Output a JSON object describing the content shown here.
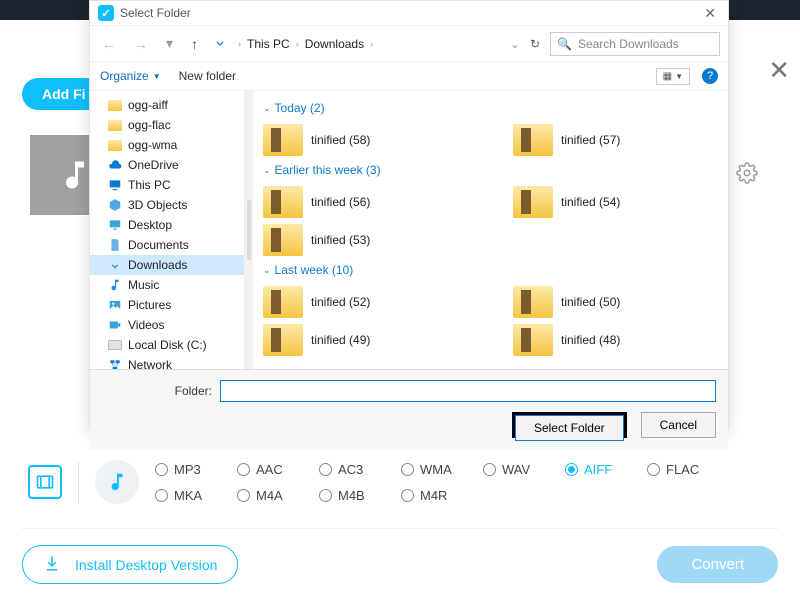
{
  "app": {
    "add_files_label": "Add Fi"
  },
  "dialog": {
    "title": "Select Folder",
    "nav": {
      "crumb_root": "This PC",
      "crumb_folder": "Downloads"
    },
    "search_placeholder": "Search Downloads",
    "toolbar": {
      "organize": "Organize",
      "new_folder": "New folder"
    },
    "tree": [
      {
        "label": "ogg-aiff",
        "icon": "folder",
        "selected": false
      },
      {
        "label": "ogg-flac",
        "icon": "folder",
        "selected": false
      },
      {
        "label": "ogg-wma",
        "icon": "folder",
        "selected": false
      },
      {
        "label": "OneDrive",
        "icon": "cloud",
        "selected": false
      },
      {
        "label": "This PC",
        "icon": "monitor",
        "selected": false
      },
      {
        "label": "3D Objects",
        "icon": "cube",
        "selected": false
      },
      {
        "label": "Desktop",
        "icon": "desktop",
        "selected": false
      },
      {
        "label": "Documents",
        "icon": "doc",
        "selected": false
      },
      {
        "label": "Downloads",
        "icon": "download",
        "selected": true
      },
      {
        "label": "Music",
        "icon": "music",
        "selected": false
      },
      {
        "label": "Pictures",
        "icon": "picture",
        "selected": false
      },
      {
        "label": "Videos",
        "icon": "video",
        "selected": false
      },
      {
        "label": "Local Disk (C:)",
        "icon": "drive",
        "selected": false
      },
      {
        "label": "Network",
        "icon": "network",
        "selected": false
      }
    ],
    "groups": [
      {
        "title": "Today (2)",
        "items": [
          "tinified (58)",
          "tinified (57)"
        ]
      },
      {
        "title": "Earlier this week (3)",
        "items": [
          "tinified (56)",
          "tinified (54)",
          "tinified (53)"
        ]
      },
      {
        "title": "Last week (10)",
        "items": [
          "tinified (52)",
          "tinified (50)",
          "tinified (49)",
          "tinified (48)"
        ]
      }
    ],
    "footer": {
      "folder_label": "Folder:",
      "folder_value": "",
      "select_btn": "Select Folder",
      "cancel_btn": "Cancel"
    }
  },
  "formats": {
    "row1": [
      "MP3",
      "AAC",
      "AC3",
      "WMA",
      "WAV",
      "AIFF",
      "FLAC"
    ],
    "row2": [
      "MKA",
      "M4A",
      "M4B",
      "M4R"
    ],
    "selected": "AIFF"
  },
  "bottom": {
    "install": "Install Desktop Version",
    "convert": "Convert"
  }
}
